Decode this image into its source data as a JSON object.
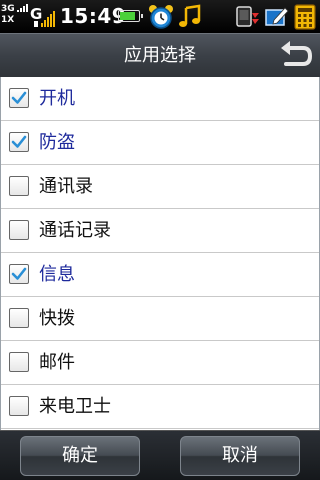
{
  "status_bar": {
    "network_top": "3G",
    "network_bottom": "1X",
    "time": "15:49"
  },
  "header": {
    "title": "应用选择"
  },
  "list": {
    "items": [
      {
        "label": "开机",
        "checked": true
      },
      {
        "label": "防盗",
        "checked": true
      },
      {
        "label": "通讯录",
        "checked": false
      },
      {
        "label": "通话记录",
        "checked": false
      },
      {
        "label": "信息",
        "checked": true
      },
      {
        "label": "快拨",
        "checked": false
      },
      {
        "label": "邮件",
        "checked": false
      },
      {
        "label": "来电卫士",
        "checked": false
      }
    ]
  },
  "footer": {
    "confirm_label": "确定",
    "cancel_label": "取消"
  },
  "colors": {
    "checked_text": "#1e2a9c",
    "check_mark": "#2a8fd6",
    "battery_fill": "#4bd13a"
  },
  "icons": {
    "back": "back-arrow-icon",
    "alarm": "alarm-clock-icon",
    "music": "music-note-icon"
  }
}
